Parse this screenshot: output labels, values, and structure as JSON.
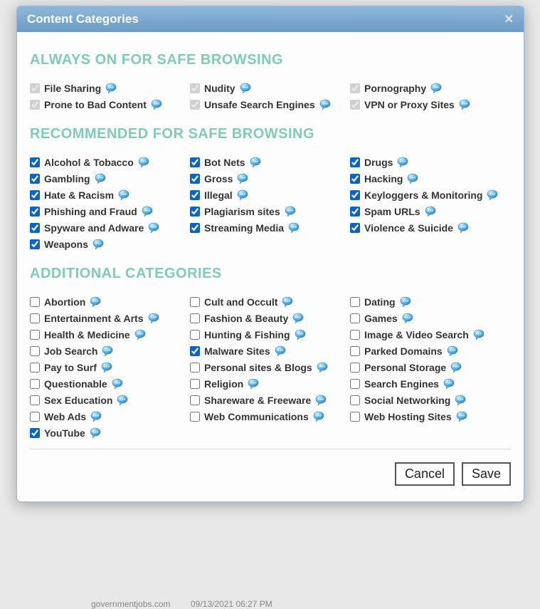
{
  "dialog": {
    "title": "Content Categories"
  },
  "sections": {
    "always_on": {
      "heading": "ALWAYS ON FOR SAFE BROWSING",
      "items": [
        {
          "label": "File Sharing",
          "checked": true,
          "disabled": true
        },
        {
          "label": "Nudity",
          "checked": true,
          "disabled": true
        },
        {
          "label": "Pornography",
          "checked": true,
          "disabled": true
        },
        {
          "label": "Prone to Bad Content",
          "checked": true,
          "disabled": true
        },
        {
          "label": "Unsafe Search Engines",
          "checked": true,
          "disabled": true
        },
        {
          "label": "VPN or Proxy Sites",
          "checked": true,
          "disabled": true
        }
      ]
    },
    "recommended": {
      "heading": "RECOMMENDED FOR SAFE BROWSING",
      "items": [
        {
          "label": "Alcohol & Tobacco",
          "checked": true,
          "disabled": false
        },
        {
          "label": "Bot Nets",
          "checked": true,
          "disabled": false
        },
        {
          "label": "Drugs",
          "checked": true,
          "disabled": false
        },
        {
          "label": "Gambling",
          "checked": true,
          "disabled": false
        },
        {
          "label": "Gross",
          "checked": true,
          "disabled": false
        },
        {
          "label": "Hacking",
          "checked": true,
          "disabled": false
        },
        {
          "label": "Hate & Racism",
          "checked": true,
          "disabled": false
        },
        {
          "label": "Illegal",
          "checked": true,
          "disabled": false
        },
        {
          "label": "Keyloggers & Monitoring",
          "checked": true,
          "disabled": false
        },
        {
          "label": "Phishing and Fraud",
          "checked": true,
          "disabled": false
        },
        {
          "label": "Plagiarism sites",
          "checked": true,
          "disabled": false
        },
        {
          "label": "Spam URLs",
          "checked": true,
          "disabled": false
        },
        {
          "label": "Spyware and Adware",
          "checked": true,
          "disabled": false
        },
        {
          "label": "Streaming Media",
          "checked": true,
          "disabled": false
        },
        {
          "label": "Violence & Suicide",
          "checked": true,
          "disabled": false
        },
        {
          "label": "Weapons",
          "checked": true,
          "disabled": false
        }
      ]
    },
    "additional": {
      "heading": "ADDITIONAL CATEGORIES",
      "items": [
        {
          "label": "Abortion",
          "checked": false,
          "disabled": false
        },
        {
          "label": "Cult and Occult",
          "checked": false,
          "disabled": false
        },
        {
          "label": "Dating",
          "checked": false,
          "disabled": false
        },
        {
          "label": "Entertainment & Arts",
          "checked": false,
          "disabled": false
        },
        {
          "label": "Fashion & Beauty",
          "checked": false,
          "disabled": false
        },
        {
          "label": "Games",
          "checked": false,
          "disabled": false
        },
        {
          "label": "Health & Medicine",
          "checked": false,
          "disabled": false
        },
        {
          "label": "Hunting & Fishing",
          "checked": false,
          "disabled": false
        },
        {
          "label": "Image & Video Search",
          "checked": false,
          "disabled": false
        },
        {
          "label": "Job Search",
          "checked": false,
          "disabled": false
        },
        {
          "label": "Malware Sites",
          "checked": true,
          "disabled": false
        },
        {
          "label": "Parked Domains",
          "checked": false,
          "disabled": false
        },
        {
          "label": "Pay to Surf",
          "checked": false,
          "disabled": false
        },
        {
          "label": "Personal sites & Blogs",
          "checked": false,
          "disabled": false
        },
        {
          "label": "Personal Storage",
          "checked": false,
          "disabled": false
        },
        {
          "label": "Questionable",
          "checked": false,
          "disabled": false
        },
        {
          "label": "Religion",
          "checked": false,
          "disabled": false
        },
        {
          "label": "Search Engines",
          "checked": false,
          "disabled": false
        },
        {
          "label": "Sex Education",
          "checked": false,
          "disabled": false
        },
        {
          "label": "Shareware & Freeware",
          "checked": false,
          "disabled": false
        },
        {
          "label": "Social Networking",
          "checked": false,
          "disabled": false
        },
        {
          "label": "Web Ads",
          "checked": false,
          "disabled": false
        },
        {
          "label": "Web Communications",
          "checked": false,
          "disabled": false
        },
        {
          "label": "Web Hosting Sites",
          "checked": false,
          "disabled": false
        },
        {
          "label": "YouTube",
          "checked": true,
          "disabled": false
        }
      ]
    }
  },
  "footer": {
    "cancel": "Cancel",
    "save": "Save"
  },
  "background": {
    "text1": "governmentjobs.com",
    "text2": "09/13/2021 06:27 PM"
  }
}
